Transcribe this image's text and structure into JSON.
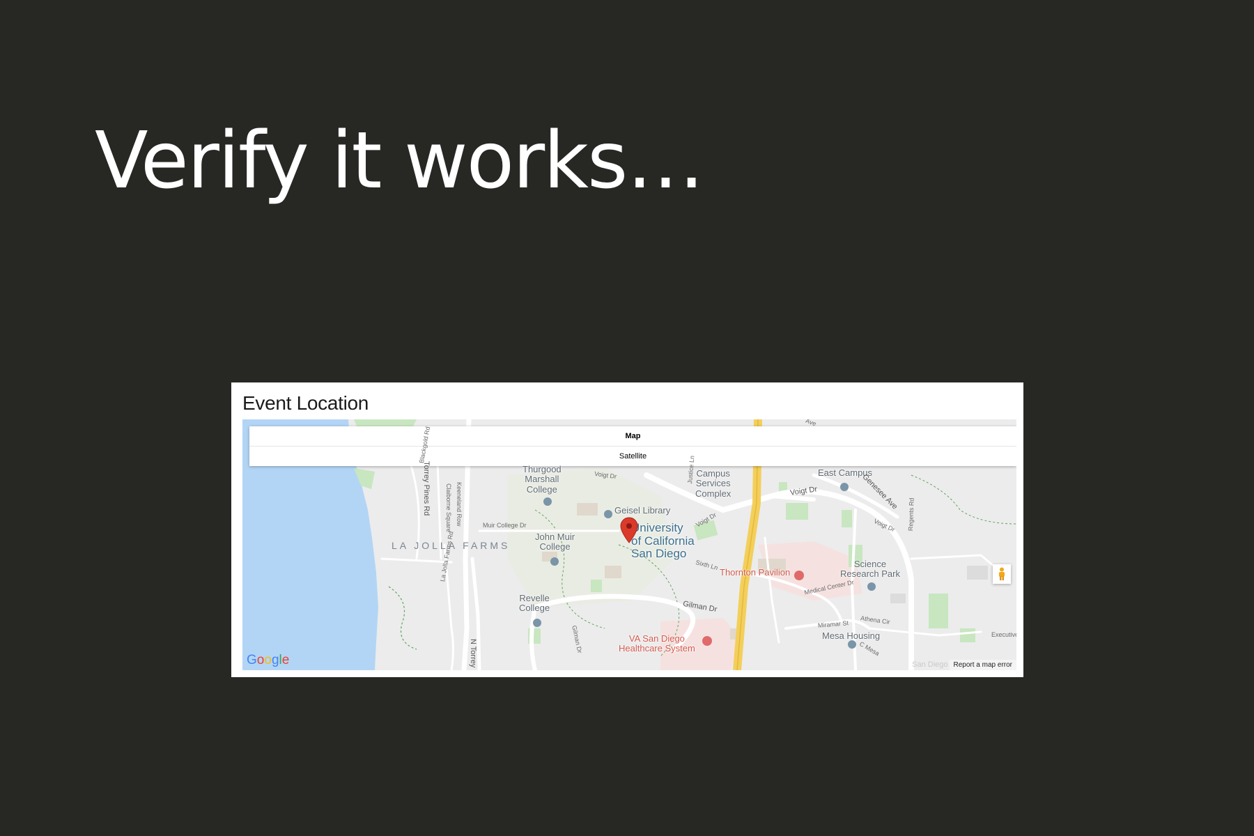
{
  "slide": {
    "title": "Verify it works…"
  },
  "card": {
    "title": "Event Location"
  },
  "map": {
    "type_control": {
      "options": [
        "Map",
        "Satellite"
      ],
      "selected": "Map"
    },
    "labels": {
      "thurgood": "Thurgood\nMarshall\nCollege",
      "campus_services": "Campus\nServices\nComplex",
      "east_campus": "East Campus",
      "geisel": "Geisel Library",
      "ucsd": "University\nof California\nSan Diego",
      "john_muir": "John Muir\nCollege",
      "la_jolla_farms": "LA JOLLA FARMS",
      "thornton": "Thornton Pavilion",
      "science_park": "Science\nResearch Park",
      "revelle": "Revelle\nCollege",
      "va": "VA San Diego\nHealthcare System",
      "mesa_housing": "Mesa Housing",
      "torrey_pines": "Torrey Pines Rd",
      "voigt_dr_1": "Voigt Dr",
      "voigt_dr_2": "Voigt Dr",
      "voigt_dr_3": "Voigt Dr",
      "voigt_dr_4": "Voigt Dr",
      "genesee": "Genesee Ave",
      "gilman_dr": "Gilman Dr",
      "gilman_dr_2": "Gilman Dr",
      "n_torrey": "N Torrey",
      "muir_college_dr": "Muir College Dr",
      "blackgold": "Blackgold Rd",
      "keeneland": "Keeneland Row",
      "claiborne": "Claiborne Square",
      "la_jolla_farms_rd": "La Jolla Farms Rd",
      "justice": "Justice Ln",
      "regents": "Regents Rd",
      "medical_center": "Medical Center Dr",
      "athena": "Athena Cir",
      "miramar": "Miramar St",
      "executive": "Executive",
      "c_mesa": "C Mesa",
      "ave_top": "Ave",
      "sixth_ln": "Sixth Ln"
    },
    "google_logo": "Google",
    "footer_faded": "San Diego",
    "report_link": "Report a map error",
    "colors": {
      "water": "#b3d5f5",
      "land": "#ececec",
      "park": "#c8e6c0",
      "medical": "#f5e2e0",
      "highway": "#f3cf5b",
      "road": "#ffffff",
      "marker": "#db3a2b"
    }
  }
}
